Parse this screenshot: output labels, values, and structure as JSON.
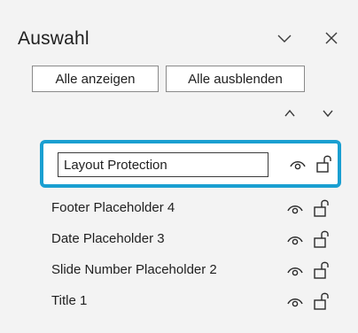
{
  "pane": {
    "title": "Auswahl",
    "collapse_icon": "chevron-down-icon",
    "close_icon": "close-icon"
  },
  "buttons": {
    "show_all": "Alle anzeigen",
    "hide_all": "Alle ausblenden"
  },
  "reorder": {
    "up_icon": "chevron-up-icon",
    "down_icon": "chevron-down-icon"
  },
  "selected": {
    "edit_value": "Layout Protection",
    "visibility_icon": "eye-icon",
    "lock_icon": "unlocked-icon"
  },
  "items": [
    {
      "label": "Footer Placeholder 4"
    },
    {
      "label": "Date Placeholder 3"
    },
    {
      "label": "Slide Number Placeholder 2"
    },
    {
      "label": "Title 1"
    }
  ],
  "colors": {
    "accent": "#1a9fd1",
    "pane_bg": "#f3f3f3"
  }
}
